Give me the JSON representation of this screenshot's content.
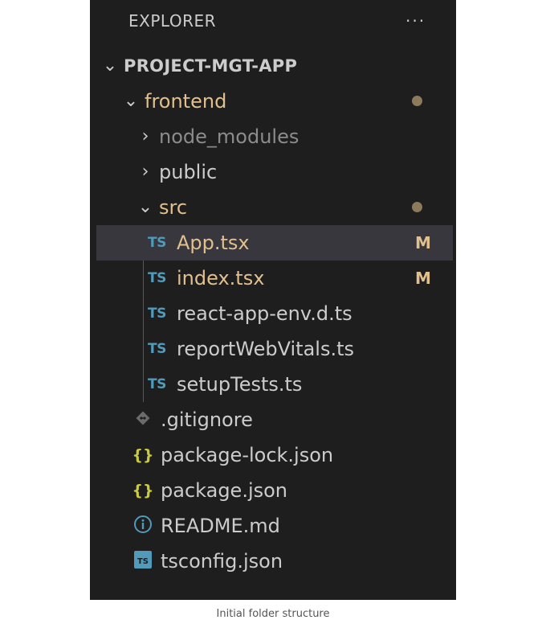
{
  "explorer": {
    "title": "EXPLORER",
    "more_icon": "ellipsis-icon",
    "more_label": "···"
  },
  "tree": {
    "project": {
      "label": "PROJECT-MGT-APP",
      "expanded": true
    },
    "frontend": {
      "label": "frontend",
      "expanded": true,
      "status": "modified-dot"
    },
    "node_modules": {
      "label": "node_modules",
      "expanded": false
    },
    "public": {
      "label": "public",
      "expanded": false
    },
    "src": {
      "label": "src",
      "expanded": true,
      "status": "modified-dot"
    },
    "files_in_src": [
      {
        "label": "App.tsx",
        "icon": "ts",
        "badge": "M",
        "selected": true
      },
      {
        "label": "index.tsx",
        "icon": "ts",
        "badge": "M"
      },
      {
        "label": "react-app-env.d.ts",
        "icon": "ts"
      },
      {
        "label": "reportWebVitals.ts",
        "icon": "ts"
      },
      {
        "label": "setupTests.ts",
        "icon": "ts"
      }
    ],
    "root_files": [
      {
        "label": ".gitignore",
        "icon": "git-icon"
      },
      {
        "label": "package-lock.json",
        "icon": "json-braces-icon"
      },
      {
        "label": "package.json",
        "icon": "json-braces-icon"
      },
      {
        "label": "README.md",
        "icon": "info-icon"
      },
      {
        "label": "tsconfig.json",
        "icon": "tsconfig-icon"
      }
    ],
    "ts_icon_text": "TS",
    "braces_text": "{}"
  },
  "colors": {
    "background": "#1e1e1e",
    "modified": "#e2c08d",
    "ts_blue": "#519aba",
    "json_yellow": "#cbcb41",
    "selected_row": "#37373d"
  },
  "caption": "Initial folder structure"
}
